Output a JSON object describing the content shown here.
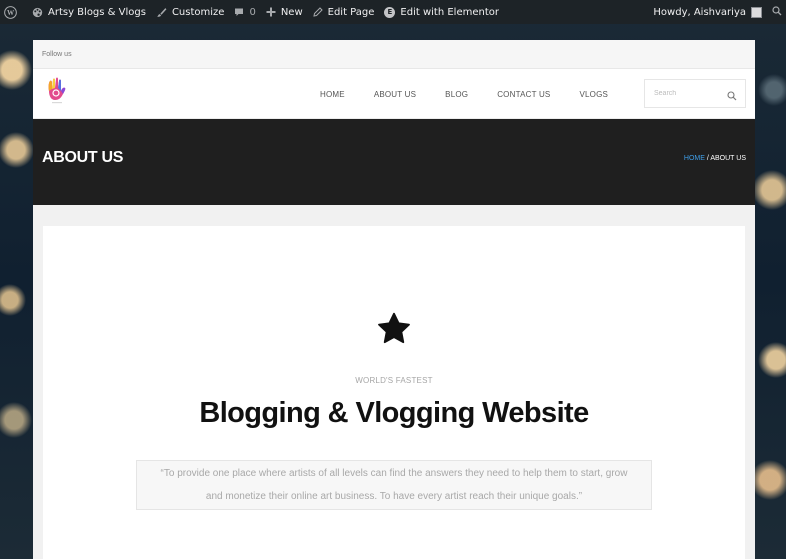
{
  "admin_bar": {
    "site_name": "Artsy Blogs & Vlogs",
    "customize": "Customize",
    "comments_count": "0",
    "new": "New",
    "edit_page": "Edit Page",
    "edit_elementor": "Edit with Elementor",
    "howdy": "Howdy, Aishvariya"
  },
  "topbar": {
    "follow_us": "Follow us"
  },
  "nav": {
    "items": [
      "HOME",
      "ABOUT US",
      "BLOG",
      "CONTACT US",
      "VLOGS"
    ]
  },
  "search": {
    "placeholder": "Search"
  },
  "titlebar": {
    "title": "ABOUT US",
    "breadcrumb_home": "HOME",
    "breadcrumb_sep": " / ",
    "breadcrumb_current": "ABOUT US"
  },
  "content": {
    "kicker": "WORLD'S FASTEST",
    "headline": "Blogging & Vlogging Website",
    "quote": "“To provide one place where artists of all levels can find the answers they need to help them to start, grow and monetize their online art business. To have every artist reach their unique goals.”"
  },
  "icons": {
    "wordpress": "wordpress-logo-icon",
    "site": "palette-icon",
    "customize": "brush-icon",
    "comments": "comment-bubble-icon",
    "new": "plus-icon",
    "edit": "pencil-icon",
    "elementor": "elementor-icon",
    "search": "search-icon",
    "feature": "star-icon"
  },
  "colors": {
    "admin_bar": "#1d2327",
    "titlebar": "#1f1f1f",
    "breadcrumb_link": "#3f9ee8",
    "headline": "#111111"
  }
}
